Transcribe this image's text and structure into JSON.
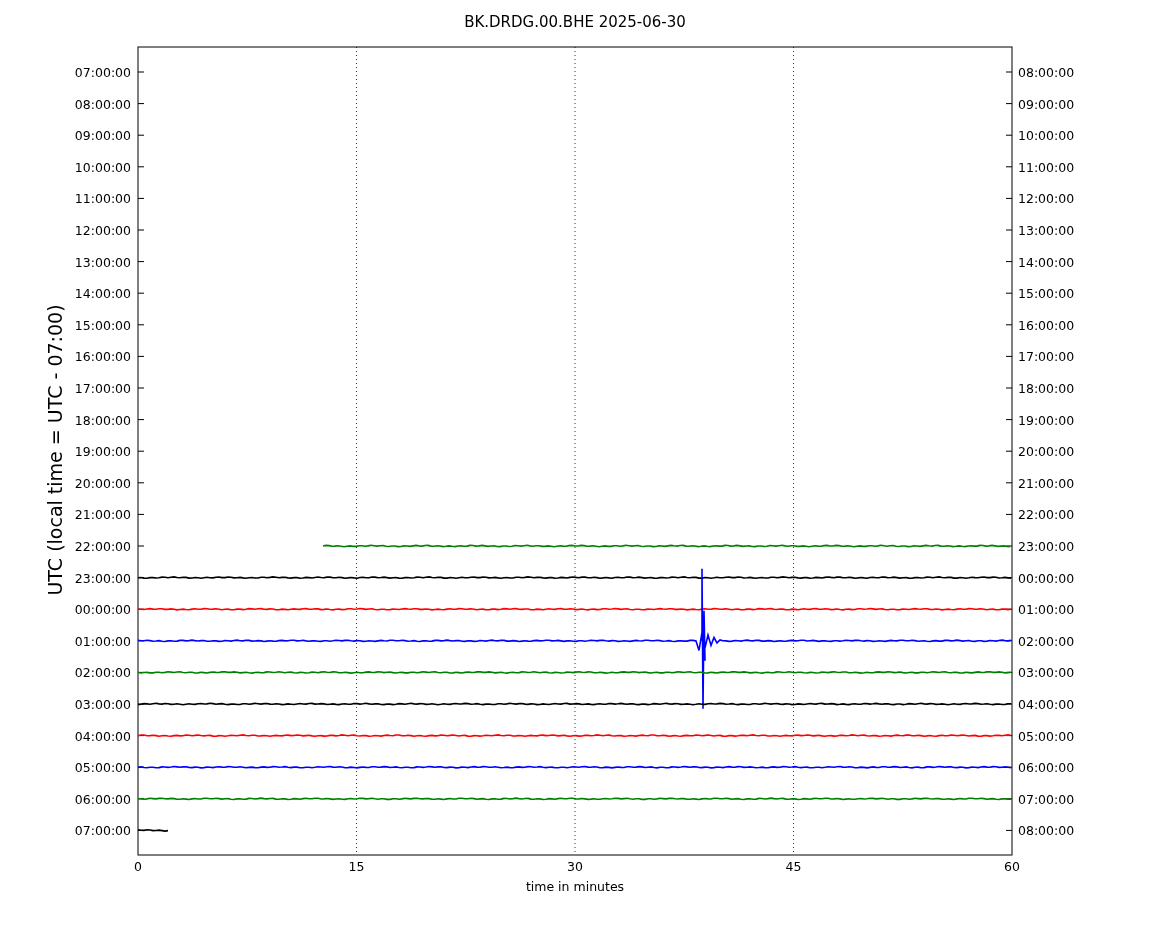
{
  "chart": {
    "title": "BK.DRDG.00.BHE 2025-06-30",
    "ylabel": "UTC (local time = UTC - 07:00)",
    "xlabel": "time in minutes",
    "xticks": [
      "0",
      "15",
      "30",
      "45",
      "60"
    ],
    "rows": [
      {
        "left": "07:00:00",
        "right": "08:00:00",
        "kind": "none"
      },
      {
        "left": "08:00:00",
        "right": "09:00:00",
        "kind": "none"
      },
      {
        "left": "09:00:00",
        "right": "10:00:00",
        "kind": "none"
      },
      {
        "left": "10:00:00",
        "right": "11:00:00",
        "kind": "none"
      },
      {
        "left": "11:00:00",
        "right": "12:00:00",
        "kind": "none"
      },
      {
        "left": "12:00:00",
        "right": "13:00:00",
        "kind": "none"
      },
      {
        "left": "13:00:00",
        "right": "14:00:00",
        "kind": "none"
      },
      {
        "left": "14:00:00",
        "right": "15:00:00",
        "kind": "none"
      },
      {
        "left": "15:00:00",
        "right": "16:00:00",
        "kind": "none"
      },
      {
        "left": "16:00:00",
        "right": "17:00:00",
        "kind": "none"
      },
      {
        "left": "17:00:00",
        "right": "18:00:00",
        "kind": "none"
      },
      {
        "left": "18:00:00",
        "right": "19:00:00",
        "kind": "none"
      },
      {
        "left": "19:00:00",
        "right": "20:00:00",
        "kind": "none"
      },
      {
        "left": "20:00:00",
        "right": "21:00:00",
        "kind": "none"
      },
      {
        "left": "21:00:00",
        "right": "22:00:00",
        "kind": "none"
      },
      {
        "left": "22:00:00",
        "right": "23:00:00",
        "kind": "starts-late",
        "color": "#008000"
      },
      {
        "left": "23:00:00",
        "right": "00:00:00",
        "kind": "full",
        "color": "#000000"
      },
      {
        "left": "00:00:00",
        "right": "01:00:00",
        "kind": "full",
        "color": "#ff0000"
      },
      {
        "left": "01:00:00",
        "right": "02:00:00",
        "kind": "full",
        "color": "#0000ff",
        "burst": true
      },
      {
        "left": "02:00:00",
        "right": "03:00:00",
        "kind": "full",
        "color": "#008000"
      },
      {
        "left": "03:00:00",
        "right": "04:00:00",
        "kind": "full",
        "color": "#000000"
      },
      {
        "left": "04:00:00",
        "right": "05:00:00",
        "kind": "full",
        "color": "#ff0000"
      },
      {
        "left": "05:00:00",
        "right": "06:00:00",
        "kind": "full",
        "color": "#0000ff"
      },
      {
        "left": "06:00:00",
        "right": "07:00:00",
        "kind": "full",
        "color": "#008000"
      },
      {
        "left": "07:00:00",
        "right": "08:00:00",
        "kind": "ends-early",
        "color": "#000000"
      }
    ]
  }
}
